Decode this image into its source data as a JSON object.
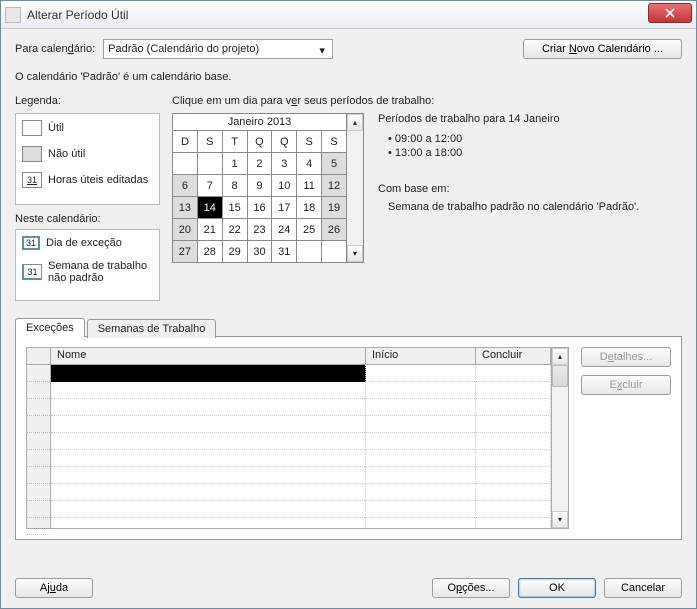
{
  "window": {
    "title": "Alterar Período Útil"
  },
  "topRow": {
    "label": "Para calendário:",
    "combo_value": "Padrão (Calendário do projeto)",
    "new_calendar": "Criar Novo Calendário ..."
  },
  "info": "O calendário 'Padrão' é um calendário base.",
  "legend": {
    "title": "Legenda:",
    "util": "Útil",
    "nao_util": "Não útil",
    "horas_editadas": "Horas úteis editadas",
    "neste_calendario": "Neste calendário:",
    "dia_excecao": "Dia de exceção",
    "semana_nao_padrao": "Semana de trabalho não padrão",
    "day31": "31"
  },
  "calendar": {
    "instruction": "Clique em um dia para ver seus períodos de trabalho:",
    "month_title": "Janeiro 2013",
    "dow": [
      "D",
      "S",
      "T",
      "Q",
      "Q",
      "S",
      "S"
    ],
    "weeks": [
      [
        {
          "d": "",
          "c": ""
        },
        {
          "d": "",
          "c": ""
        },
        {
          "d": "1",
          "c": ""
        },
        {
          "d": "2",
          "c": ""
        },
        {
          "d": "3",
          "c": ""
        },
        {
          "d": "4",
          "c": ""
        },
        {
          "d": "5",
          "c": "nonwork"
        }
      ],
      [
        {
          "d": "6",
          "c": "nonwork"
        },
        {
          "d": "7",
          "c": ""
        },
        {
          "d": "8",
          "c": ""
        },
        {
          "d": "9",
          "c": ""
        },
        {
          "d": "10",
          "c": ""
        },
        {
          "d": "11",
          "c": ""
        },
        {
          "d": "12",
          "c": "nonwork"
        }
      ],
      [
        {
          "d": "13",
          "c": "nonwork"
        },
        {
          "d": "14",
          "c": "selected"
        },
        {
          "d": "15",
          "c": ""
        },
        {
          "d": "16",
          "c": ""
        },
        {
          "d": "17",
          "c": ""
        },
        {
          "d": "18",
          "c": ""
        },
        {
          "d": "19",
          "c": "nonwork"
        }
      ],
      [
        {
          "d": "20",
          "c": "nonwork"
        },
        {
          "d": "21",
          "c": ""
        },
        {
          "d": "22",
          "c": ""
        },
        {
          "d": "23",
          "c": ""
        },
        {
          "d": "24",
          "c": ""
        },
        {
          "d": "25",
          "c": ""
        },
        {
          "d": "26",
          "c": "nonwork"
        }
      ],
      [
        {
          "d": "27",
          "c": "nonwork"
        },
        {
          "d": "28",
          "c": ""
        },
        {
          "d": "29",
          "c": ""
        },
        {
          "d": "30",
          "c": ""
        },
        {
          "d": "31",
          "c": ""
        },
        {
          "d": "",
          "c": ""
        },
        {
          "d": "",
          "c": ""
        }
      ]
    ]
  },
  "periods": {
    "title": "Períodos de trabalho para 14 Janeiro",
    "items": [
      "09:00 a 12:00",
      "13:00 a 18:00"
    ],
    "base_title": "Com base em:",
    "base_text": "Semana de trabalho padrão no calendário 'Padrão'."
  },
  "tabs": {
    "excecoes": "Exceções",
    "semanas": "Semanas de Trabalho"
  },
  "grid": {
    "col_nome": "Nome",
    "col_inicio": "Início",
    "col_concluir": "Concluir"
  },
  "sideButtons": {
    "detalhes": "Detalhes...",
    "excluir": "Excluir"
  },
  "footer": {
    "ajuda": "Ajuda",
    "opcoes": "Opções...",
    "ok": "OK",
    "cancelar": "Cancelar"
  }
}
